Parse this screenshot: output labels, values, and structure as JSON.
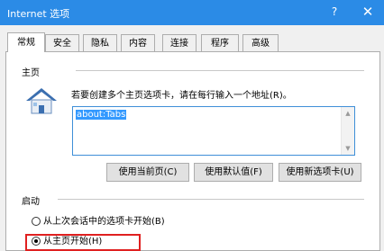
{
  "window": {
    "title": "Internet 选项",
    "help": "?",
    "close": "✕"
  },
  "tabs": [
    "常规",
    "安全",
    "隐私",
    "内容",
    "连接",
    "程序",
    "高级"
  ],
  "home": {
    "group_label": "主页",
    "description": "若要创建多个主页选项卡，请在每行输入一个地址(R)。",
    "url": "about:Tabs",
    "buttons": [
      "使用当前页(C)",
      "使用默认值(F)",
      "使用新选项卡(U)"
    ]
  },
  "startup": {
    "group_label": "启动",
    "options": [
      {
        "label": "从上次会话中的选项卡开始(B)",
        "checked": false
      },
      {
        "label": "从主页开始(H)",
        "checked": true
      }
    ]
  },
  "colors": {
    "titlebar": "#2b8be6",
    "highlight": "#e02020",
    "selection": "#3399ff"
  }
}
